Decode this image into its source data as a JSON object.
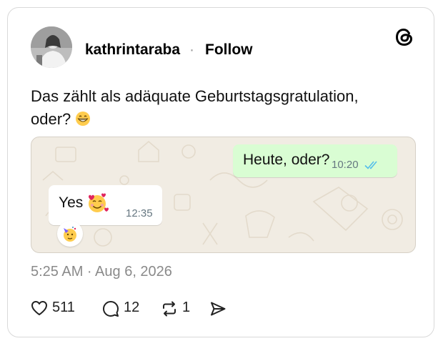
{
  "post": {
    "username": "kathrintaraba",
    "separator": "·",
    "follow_label": "Follow",
    "text_line1": "Das zählt als adäquate Geburtstagsgratulation,",
    "text_line2": "oder?",
    "timestamp": "5:25 AM · Aug 6, 2026"
  },
  "media": {
    "outgoing": {
      "text": "Heute, oder?",
      "time": "10:20"
    },
    "incoming": {
      "text": "Yes",
      "time": "12:35"
    }
  },
  "actions": {
    "likes": "511",
    "replies": "12",
    "reposts": "1"
  },
  "colors": {
    "outgoing_bubble": "#d9fdd3",
    "chat_background": "#f1ece3",
    "read_ticks": "#53bdeb"
  }
}
